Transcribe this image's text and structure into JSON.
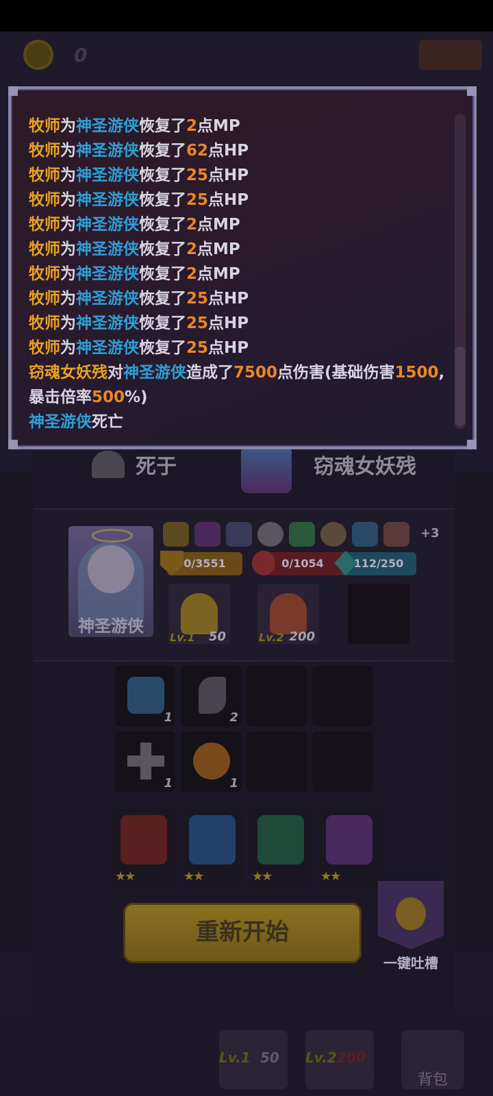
{
  "header": {
    "coin_count": "0"
  },
  "battle_log": {
    "lines": [
      {
        "actor": "牧师",
        "mid": "为",
        "target": "神圣游侠",
        "verb": "恢复了",
        "num": "2",
        "unit": "点MP"
      },
      {
        "actor": "牧师",
        "mid": "为",
        "target": "神圣游侠",
        "verb": "恢复了",
        "num": "62",
        "unit": "点HP"
      },
      {
        "actor": "牧师",
        "mid": "为",
        "target": "神圣游侠",
        "verb": "恢复了",
        "num": "25",
        "unit": "点HP"
      },
      {
        "actor": "牧师",
        "mid": "为",
        "target": "神圣游侠",
        "verb": "恢复了",
        "num": "25",
        "unit": "点HP"
      },
      {
        "actor": "牧师",
        "mid": "为",
        "target": "神圣游侠",
        "verb": "恢复了",
        "num": "2",
        "unit": "点MP"
      },
      {
        "actor": "牧师",
        "mid": "为",
        "target": "神圣游侠",
        "verb": "恢复了",
        "num": "2",
        "unit": "点MP"
      },
      {
        "actor": "牧师",
        "mid": "为",
        "target": "神圣游侠",
        "verb": "恢复了",
        "num": "2",
        "unit": "点MP"
      },
      {
        "actor": "牧师",
        "mid": "为",
        "target": "神圣游侠",
        "verb": "恢复了",
        "num": "25",
        "unit": "点HP"
      },
      {
        "actor": "牧师",
        "mid": "为",
        "target": "神圣游侠",
        "verb": "恢复了",
        "num": "25",
        "unit": "点HP"
      },
      {
        "actor": "牧师",
        "mid": "为",
        "target": "神圣游侠",
        "verb": "恢复了",
        "num": "25",
        "unit": "点HP"
      }
    ],
    "damage": {
      "actor": "窃魂女妖残",
      "mid": "对",
      "target": "神圣游侠",
      "verb": "造成了",
      "num": "7500",
      "text1": "点伤害(基础伤害",
      "num2": "1500",
      "text2": ",暴击倍率",
      "num3": "500",
      "text3": "%)"
    },
    "death": {
      "target": "神圣游侠",
      "text": "死亡"
    }
  },
  "result": {
    "died_label": "死于",
    "killer_name": "窃魂女妖残"
  },
  "hero": {
    "name": "神圣游侠",
    "buffs_more": "+3",
    "shield": "0/3551",
    "hp": "0/1054",
    "mp": "112/250",
    "skills": [
      {
        "lv": "Lv.1",
        "cost": "50"
      },
      {
        "lv": "Lv.2",
        "cost": "200"
      }
    ]
  },
  "inventory": [
    {
      "icon": "potion-bucket-icon",
      "count": "1"
    },
    {
      "icon": "knife-icon",
      "count": "2"
    },
    {
      "icon": "cross-icon",
      "count": "1"
    },
    {
      "icon": "pudding-icon",
      "count": "1"
    }
  ],
  "equipment": [
    {
      "icon": "red-tower-icon",
      "stars": "★★"
    },
    {
      "icon": "blue-shield-icon",
      "stars": "★★"
    },
    {
      "icon": "green-clock-icon",
      "stars": "★★"
    },
    {
      "icon": "purple-priest-icon",
      "stars": "★★"
    }
  ],
  "actions": {
    "restart": "重新开始",
    "feedback": "一键吐槽"
  },
  "bottom": {
    "lv1": "Lv.1",
    "cost1": "50",
    "lv2": "Lv.2",
    "cost2": "200",
    "bag": "背包"
  },
  "colors": {
    "actor": "#e7a226",
    "target": "#2f9ed6",
    "number": "#e7862b",
    "restart_button": "#8a7020"
  }
}
